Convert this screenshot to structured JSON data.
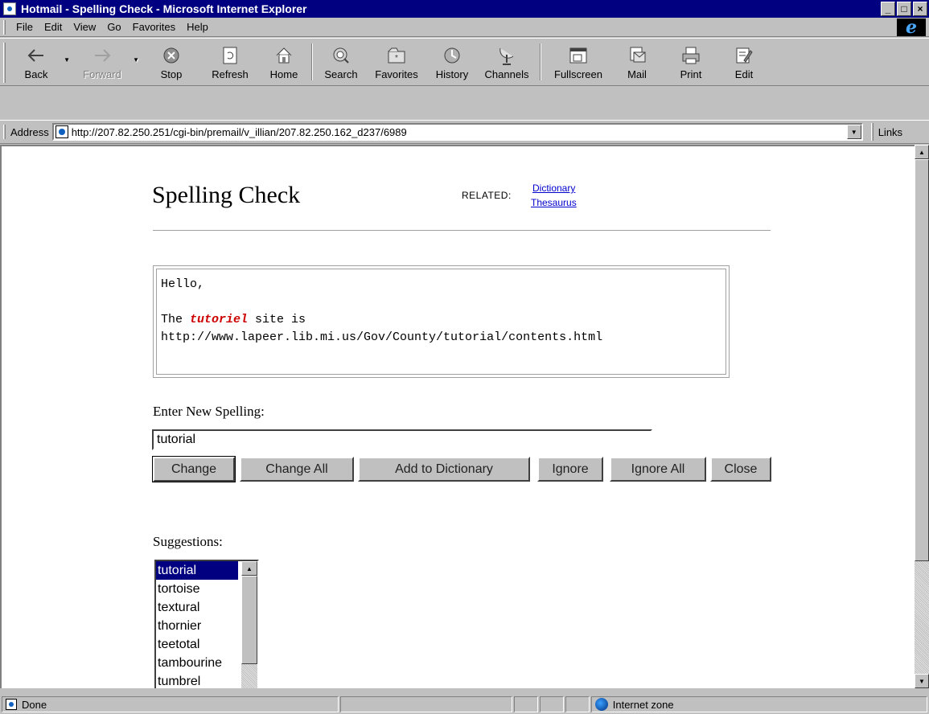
{
  "window": {
    "title": "Hotmail - Spelling Check - Microsoft Internet Explorer",
    "minimize": "_",
    "maximize": "□",
    "close": "×"
  },
  "menu": [
    "File",
    "Edit",
    "View",
    "Go",
    "Favorites",
    "Help"
  ],
  "toolbar": [
    {
      "label": "Back",
      "icon": "back-arrow-icon",
      "enabled": true,
      "dropdown": true
    },
    {
      "label": "Forward",
      "icon": "forward-arrow-icon",
      "enabled": false,
      "dropdown": true
    },
    {
      "label": "Stop",
      "icon": "stop-icon",
      "enabled": true
    },
    {
      "label": "Refresh",
      "icon": "refresh-icon",
      "enabled": true
    },
    {
      "label": "Home",
      "icon": "home-icon",
      "enabled": true
    },
    {
      "label": "Search",
      "icon": "search-icon",
      "enabled": true
    },
    {
      "label": "Favorites",
      "icon": "favorites-icon",
      "enabled": true
    },
    {
      "label": "History",
      "icon": "history-icon",
      "enabled": true
    },
    {
      "label": "Channels",
      "icon": "channels-icon",
      "enabled": true
    },
    {
      "label": "Fullscreen",
      "icon": "fullscreen-icon",
      "enabled": true
    },
    {
      "label": "Mail",
      "icon": "mail-icon",
      "enabled": true
    },
    {
      "label": "Print",
      "icon": "print-icon",
      "enabled": true
    },
    {
      "label": "Edit",
      "icon": "edit-icon",
      "enabled": true
    }
  ],
  "address": {
    "label": "Address",
    "url": "http://207.82.250.251/cgi-bin/premail/v_illian/207.82.250.162_d237/6989",
    "links": "Links"
  },
  "page": {
    "title": "Spelling Check",
    "related_label": "RELATED:",
    "related_links": [
      "Dictionary",
      "Thesaurus"
    ],
    "message": {
      "line1": "Hello,",
      "line2_prefix": "The ",
      "misspelled_word": "tutoriel",
      "line2_suffix": " site is",
      "line3": "http://www.lapeer.lib.mi.us/Gov/County/tutorial/contents.html"
    },
    "new_spelling_label": "Enter New Spelling:",
    "new_spelling_value": "tutorial",
    "buttons": {
      "change": "Change",
      "change_all": "Change All",
      "add_to_dictionary": "Add to Dictionary",
      "ignore": "Ignore",
      "ignore_all": "Ignore All",
      "close": "Close"
    },
    "suggestions_label": "Suggestions:",
    "suggestions": [
      "tutorial",
      "tortoise",
      "textural",
      "thornier",
      "teetotal",
      "tambourine",
      "tumbrel"
    ],
    "selected_suggestion": "tutorial"
  },
  "status": {
    "text": "Done",
    "zone": "Internet zone"
  },
  "colors": {
    "titlebar": "#000080",
    "link": "#0000cc",
    "misspelled": "#cc0000",
    "selection": "#000080"
  }
}
